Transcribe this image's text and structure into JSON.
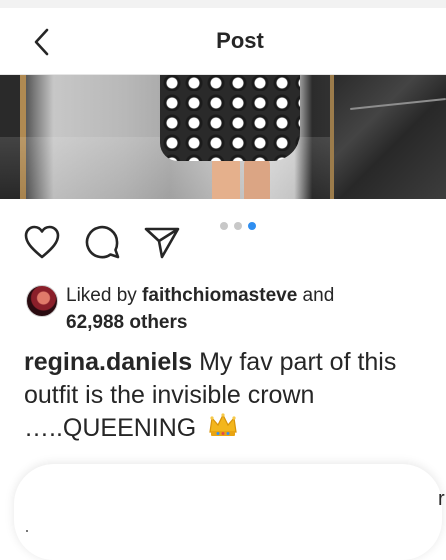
{
  "header": {
    "title": "Post"
  },
  "icons": {
    "back": "chevron-left-icon",
    "like": "heart-icon",
    "comment": "comment-bubble-icon",
    "share": "paper-plane-icon",
    "crown": "crown-emoji-icon"
  },
  "carousel": {
    "total": 3,
    "active_index": 2,
    "active_color": "#2f8ef0",
    "inactive_color": "#c8c8c8"
  },
  "likes": {
    "prefix": "Liked by ",
    "user": "faithchiomasteve",
    "middle": " and",
    "others": "62,988 others"
  },
  "caption": {
    "username": "regina.daniels",
    "text": " My fav part of this outfit is the invisible crown …..QUEENING "
  },
  "edge_text": "r"
}
